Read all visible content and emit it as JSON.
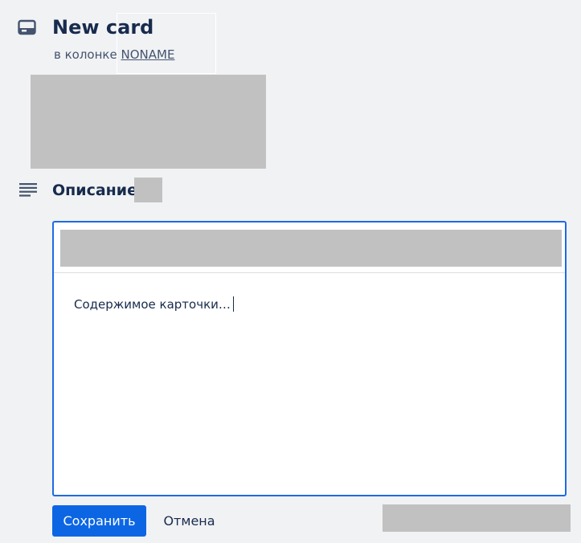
{
  "header": {
    "title": "New card",
    "subtitle_prefix": "в колонке",
    "column_name": "NONAME",
    "icon": "card-icon"
  },
  "description": {
    "heading": "Описание",
    "icon": "text-align-left-icon"
  },
  "editor": {
    "content": "Содержимое карточки…"
  },
  "actions": {
    "save_label": "Сохранить",
    "cancel_label": "Отмена"
  },
  "colors": {
    "background": "#f1f2f4",
    "text": "#172b4d",
    "accent": "#0c66e4",
    "editor_border": "#1d6ae5",
    "placeholder": "#c1c1c1"
  }
}
